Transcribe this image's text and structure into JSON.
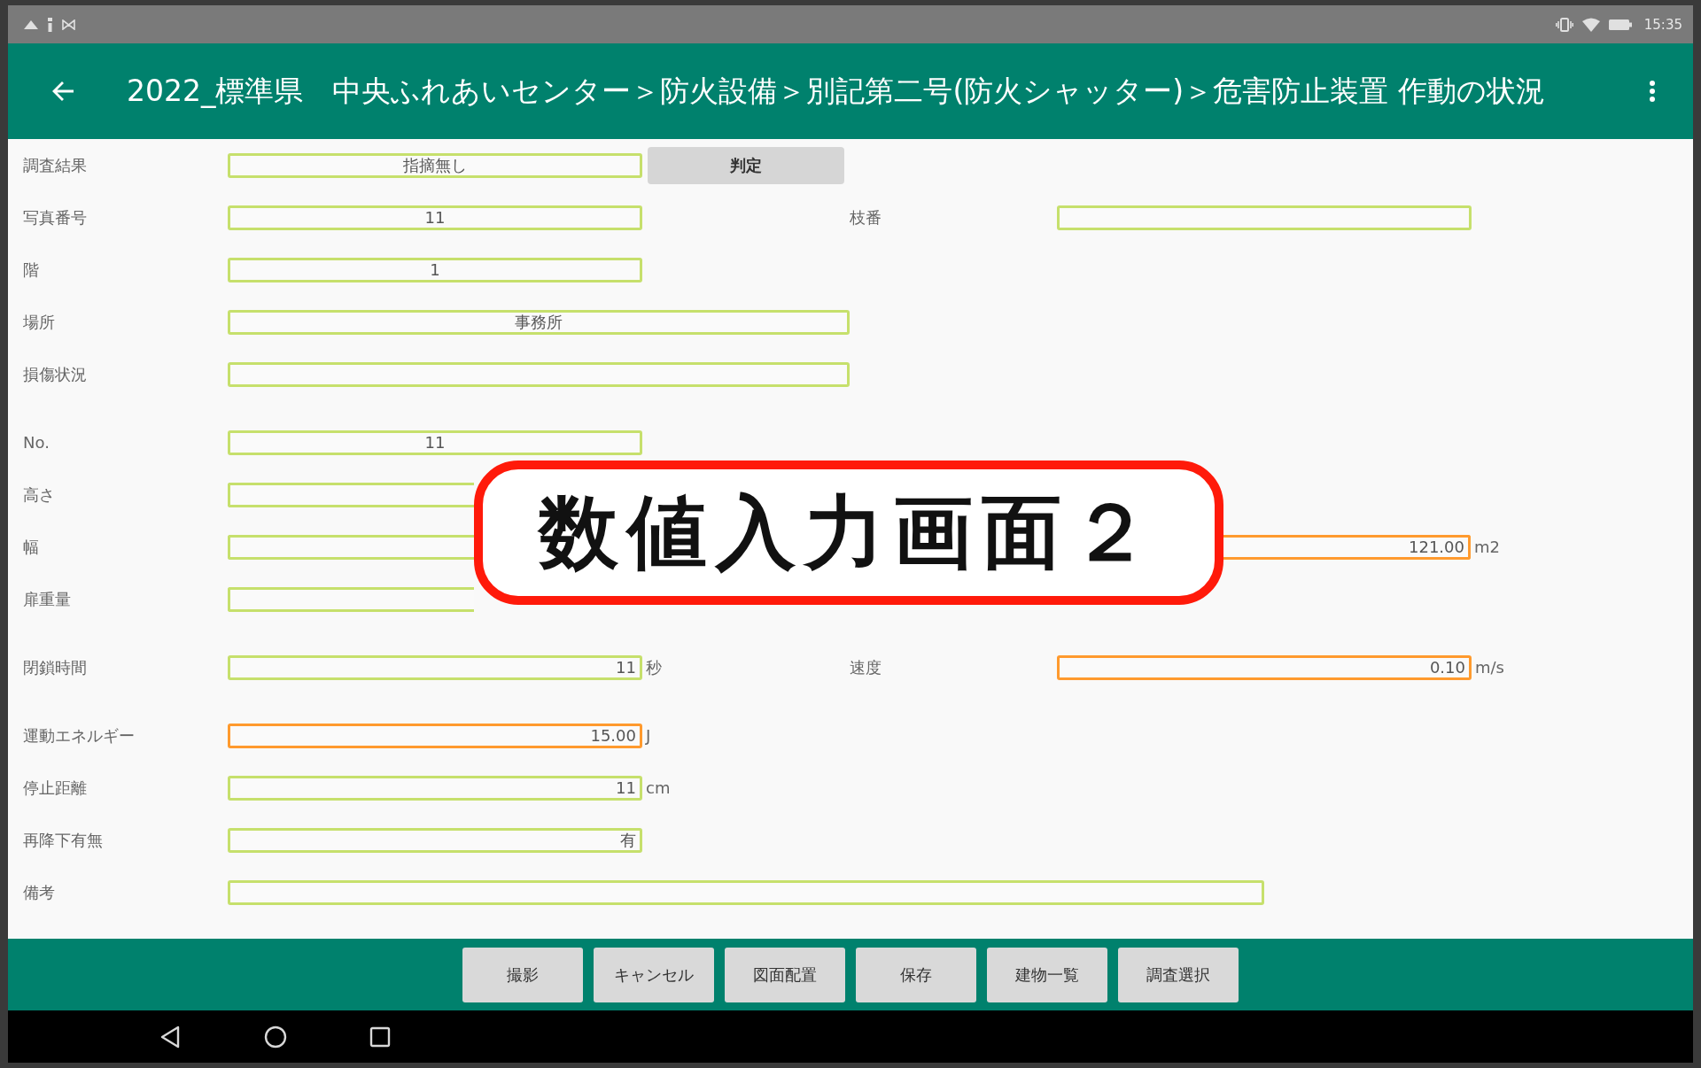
{
  "status_bar": {
    "time": "15:35"
  },
  "app_bar": {
    "title": "2022_標準県　中央ふれあいセンター＞防火設備＞別記第二号(防火シャッター)＞危害防止装置 作動の状況"
  },
  "form": {
    "groups": [
      {
        "rows": [
          {
            "label": "調査結果",
            "field": {
              "kind": "text",
              "value": "指摘無し",
              "highlighted": false,
              "covered": false
            },
            "button": {
              "label": "判定"
            }
          },
          {
            "label": "写真番号",
            "field": {
              "kind": "text",
              "value": "11",
              "highlighted": false,
              "covered": false
            },
            "right": {
              "label": "枝番",
              "field": {
                "kind": "text",
                "highlighted": false,
                "covered": false
              }
            }
          },
          {
            "label": "階",
            "field": {
              "kind": "text",
              "value": "1",
              "highlighted": false,
              "covered": false
            }
          },
          {
            "label": "場所",
            "field": {
              "kind": "line",
              "value": "事務所",
              "highlighted": false,
              "covered": false
            }
          },
          {
            "label": "損傷状況",
            "field": {
              "kind": "line",
              "highlighted": false,
              "covered": false
            }
          }
        ]
      },
      {
        "rows": [
          {
            "label": "No.",
            "field": {
              "kind": "text",
              "value": "11",
              "highlighted": false,
              "covered": false
            }
          },
          {
            "label": "高さ",
            "field": {
              "kind": "measure",
              "highlighted": false,
              "covered": true
            }
          },
          {
            "label": "幅",
            "field": {
              "kind": "measure",
              "highlighted": false,
              "covered": true
            },
            "right": {
              "field": {
                "kind": "measure",
                "value": "121.00",
                "unit": "m2",
                "highlighted": true,
                "covered": true
              }
            }
          },
          {
            "label": "扉重量",
            "field": {
              "kind": "measure",
              "highlighted": false,
              "covered": true
            }
          }
        ]
      },
      {
        "rows": [
          {
            "label": "閉鎖時間",
            "field": {
              "kind": "measure",
              "value": "11",
              "unit": "秒",
              "highlighted": false,
              "covered": false
            },
            "right": {
              "label": "速度",
              "field": {
                "kind": "measure",
                "value": "0.10",
                "unit": "m/s",
                "highlighted": true,
                "covered": false
              }
            }
          }
        ]
      },
      {
        "rows": [
          {
            "label": "運動エネルギー",
            "field": {
              "kind": "measure",
              "value": "15.00",
              "unit": "J",
              "highlighted": true,
              "covered": false
            }
          },
          {
            "label": "停止距離",
            "field": {
              "kind": "measure",
              "value": "11",
              "unit": "cm",
              "highlighted": false,
              "covered": false
            }
          },
          {
            "label": "再降下有無",
            "field": {
              "kind": "measure",
              "value": "有",
              "highlighted": false,
              "covered": false
            }
          },
          {
            "label": "備考",
            "field": {
              "kind": "memo",
              "highlighted": false,
              "covered": false
            }
          }
        ]
      }
    ]
  },
  "callout": {
    "text": "数値入力画面２"
  },
  "bottom_bar": {
    "buttons": [
      "撮影",
      "キャンセル",
      "図面配置",
      "保存",
      "建物一覧",
      "調査選択"
    ]
  }
}
